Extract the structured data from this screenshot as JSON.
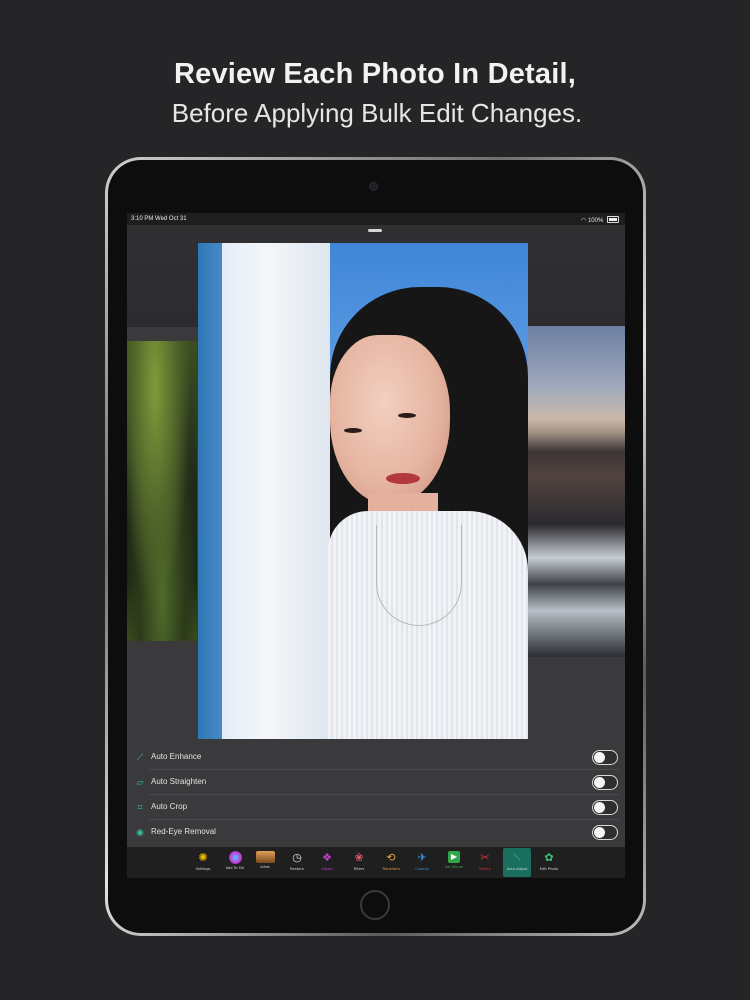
{
  "headline": {
    "line1": "Review Each Photo In Detail,",
    "line2": "Before Applying Bulk Edit Changes."
  },
  "status_bar": {
    "time": "3:10 PM",
    "date": "Wed Oct 31",
    "battery": "100%"
  },
  "settings": [
    {
      "label": "Auto Enhance",
      "icon": "magic-wand-icon",
      "enabled": false
    },
    {
      "label": "Auto Straighten",
      "icon": "straighten-icon",
      "enabled": false
    },
    {
      "label": "Auto Crop",
      "icon": "crop-icon",
      "enabled": false
    },
    {
      "label": "Red-Eye Removal",
      "icon": "eye-icon",
      "enabled": false
    }
  ],
  "toolbar": [
    {
      "label": "Settings",
      "icon": "gear-icon",
      "color": "#e9b800"
    },
    {
      "label": "Add To Siri",
      "icon": "siri-icon",
      "color": "#c13bd6"
    },
    {
      "label": "Artist",
      "icon": "artist-icon",
      "color": "#c88a3a"
    },
    {
      "label": "Restore",
      "icon": "clock-icon",
      "color": "#cfcfcf"
    },
    {
      "label": "Album",
      "icon": "album-icon",
      "color": "#c43fd0"
    },
    {
      "label": "Filters",
      "icon": "filters-icon",
      "color": "#e05a6e"
    },
    {
      "label": "Transform",
      "icon": "transform-icon",
      "color": "#e7a53c"
    },
    {
      "label": "Classify",
      "icon": "classify-icon",
      "color": "#3d8de0"
    },
    {
      "label": "Set Album",
      "icon": "play-icon",
      "color": "#2fa84a"
    },
    {
      "label": "Delete",
      "icon": "delete-icon",
      "color": "#d9303a"
    },
    {
      "label": "Auto-Adjust",
      "icon": "wand-icon",
      "color": "#2fc0a0",
      "active": true
    },
    {
      "label": "Edit Photo",
      "icon": "edit-icon",
      "color": "#3cc27a"
    }
  ]
}
